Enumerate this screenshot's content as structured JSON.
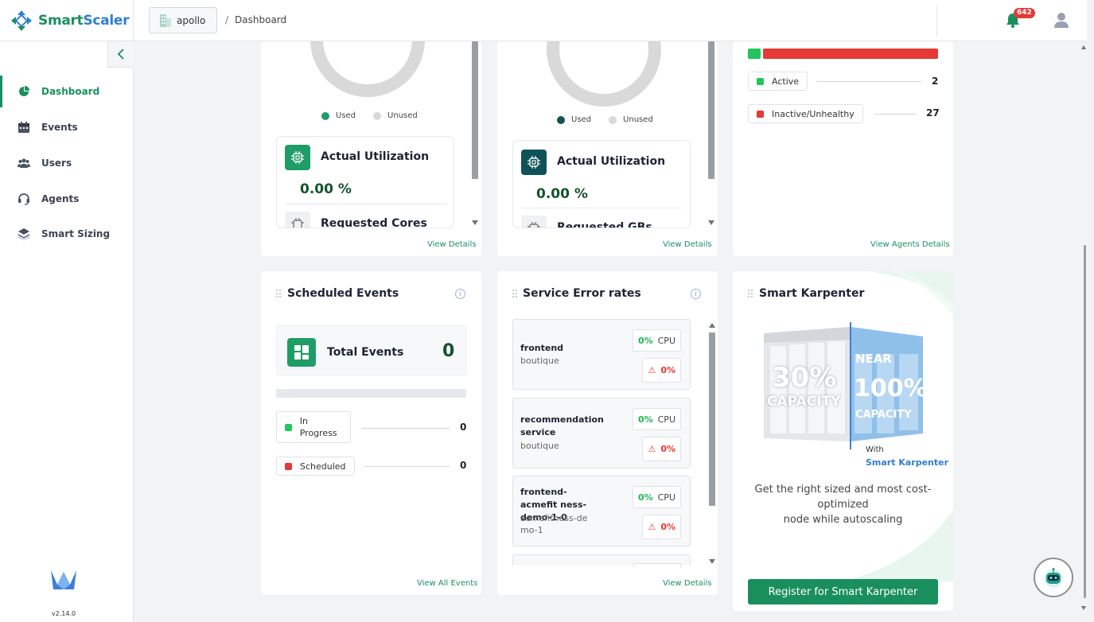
{
  "app": {
    "brand_a": "Smart",
    "brand_b": "Scaler",
    "version": "v2.14.0"
  },
  "header": {
    "org": "apollo",
    "breadcrumb_sep": "/",
    "breadcrumb": "Dashboard",
    "notification_count": "642"
  },
  "sidebar": {
    "items": [
      {
        "label": "Dashboard",
        "icon": "pie-chart-icon",
        "active": true
      },
      {
        "label": "Events",
        "icon": "calendar-icon"
      },
      {
        "label": "Users",
        "icon": "users-icon"
      },
      {
        "label": "Agents",
        "icon": "headset-icon"
      },
      {
        "label": "Smart Sizing",
        "icon": "smart-sizing-icon"
      }
    ]
  },
  "cpu_card": {
    "legend_used": "Used",
    "legend_unused": "Unused",
    "util_label": "Actual Utilization",
    "util_value": "0.00 %",
    "requested_label": "Requested Cores",
    "link": "View Details",
    "used_color": "#1f9d67"
  },
  "mem_card": {
    "legend_used": "Used",
    "legend_unused": "Unused",
    "util_label": "Actual Utilization",
    "util_value": "0.00 %",
    "requested_label": "Requested GBs",
    "link": "View Details",
    "used_color": "#0f5257"
  },
  "agents_card": {
    "active_label": "Active",
    "active_count": "2",
    "inactive_label": "Inactive/Unhealthy",
    "inactive_count": "27",
    "link": "View Agents Details",
    "active_fraction": 0.069
  },
  "events_card": {
    "title": "Scheduled Events",
    "total_label": "Total Events",
    "total_value": "0",
    "in_progress_label": "In Progress",
    "in_progress_count": "0",
    "scheduled_label": "Scheduled",
    "scheduled_count": "0",
    "link": "View All Events"
  },
  "errors_card": {
    "title": "Service Error rates",
    "services": [
      {
        "name": "frontend",
        "ns": "boutique",
        "cpu": "0%",
        "cpu_label": "CPU",
        "err": "0%"
      },
      {
        "name": "recommendation service",
        "ns": "boutique",
        "cpu": "0%",
        "cpu_label": "CPU",
        "err": "0%"
      },
      {
        "name": "frontend-acmefit ness-demo-1-0",
        "ns": "acmefitness-de mo-1",
        "cpu": "0%",
        "cpu_label": "CPU",
        "err": "0%"
      }
    ],
    "link": "View Details"
  },
  "karpenter_card": {
    "title": "Smart Karpenter",
    "img_left_top": "30%",
    "img_left_bottom": "CAPACITY",
    "img_right_top": "NEAR",
    "img_right_mid": "100%",
    "img_right_bottom": "CAPACITY",
    "with": "With",
    "with_brand": "Smart Karpenter",
    "desc_1": "Get the right sized and most cost-",
    "desc_2": "optimized",
    "desc_3": "node while autoscaling",
    "button": "Register for Smart Karpenter"
  },
  "colors": {
    "brand_green": "#1a8f5e",
    "active_green": "#22c55e",
    "inactive_red": "#e53935"
  }
}
